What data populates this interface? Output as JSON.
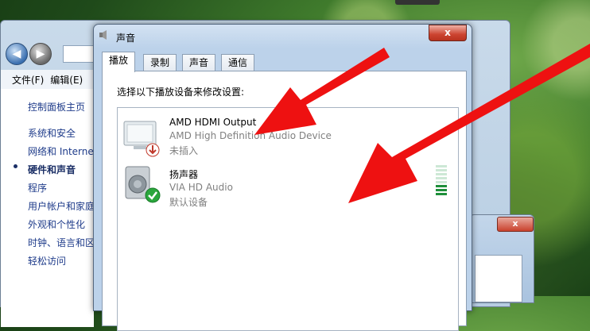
{
  "explorer": {
    "menu": [
      "文件(F)",
      "编辑(E)"
    ],
    "sidebar": [
      {
        "label": "控制面板主页",
        "bold": false
      },
      {
        "label": "系统和安全",
        "bold": false
      },
      {
        "label": "网络和 Internet",
        "bold": false
      },
      {
        "label": "硬件和声音",
        "bold": true
      },
      {
        "label": "程序",
        "bold": false
      },
      {
        "label": "用户帐户和家庭安全",
        "bold": false
      },
      {
        "label": "外观和个性化",
        "bold": false
      },
      {
        "label": "时钟、语言和区域",
        "bold": false
      },
      {
        "label": "轻松访问",
        "bold": false
      }
    ]
  },
  "dialog2": {
    "close_label": "x"
  },
  "sound_dialog": {
    "title": "声音",
    "close_label": "x",
    "tabs": [
      "播放",
      "录制",
      "声音",
      "通信"
    ],
    "active_tab": 0,
    "instruction": "选择以下播放设备来修改设置:",
    "devices": [
      {
        "name": "AMD HDMI Output",
        "description": "AMD High Definition Audio Device",
        "status": "未插入",
        "icon": "monitor-unplugged-icon"
      },
      {
        "name": "扬声器",
        "description": "VIA HD Audio",
        "status": "默认设备",
        "icon": "speaker-default-icon"
      }
    ],
    "level_meter": {
      "level": 0.35,
      "active_color": "#1e8f3a",
      "idle_color": "#cde8d6"
    }
  },
  "colors": {
    "arrow": "#ee1111",
    "accent": "#3a6fb0"
  }
}
